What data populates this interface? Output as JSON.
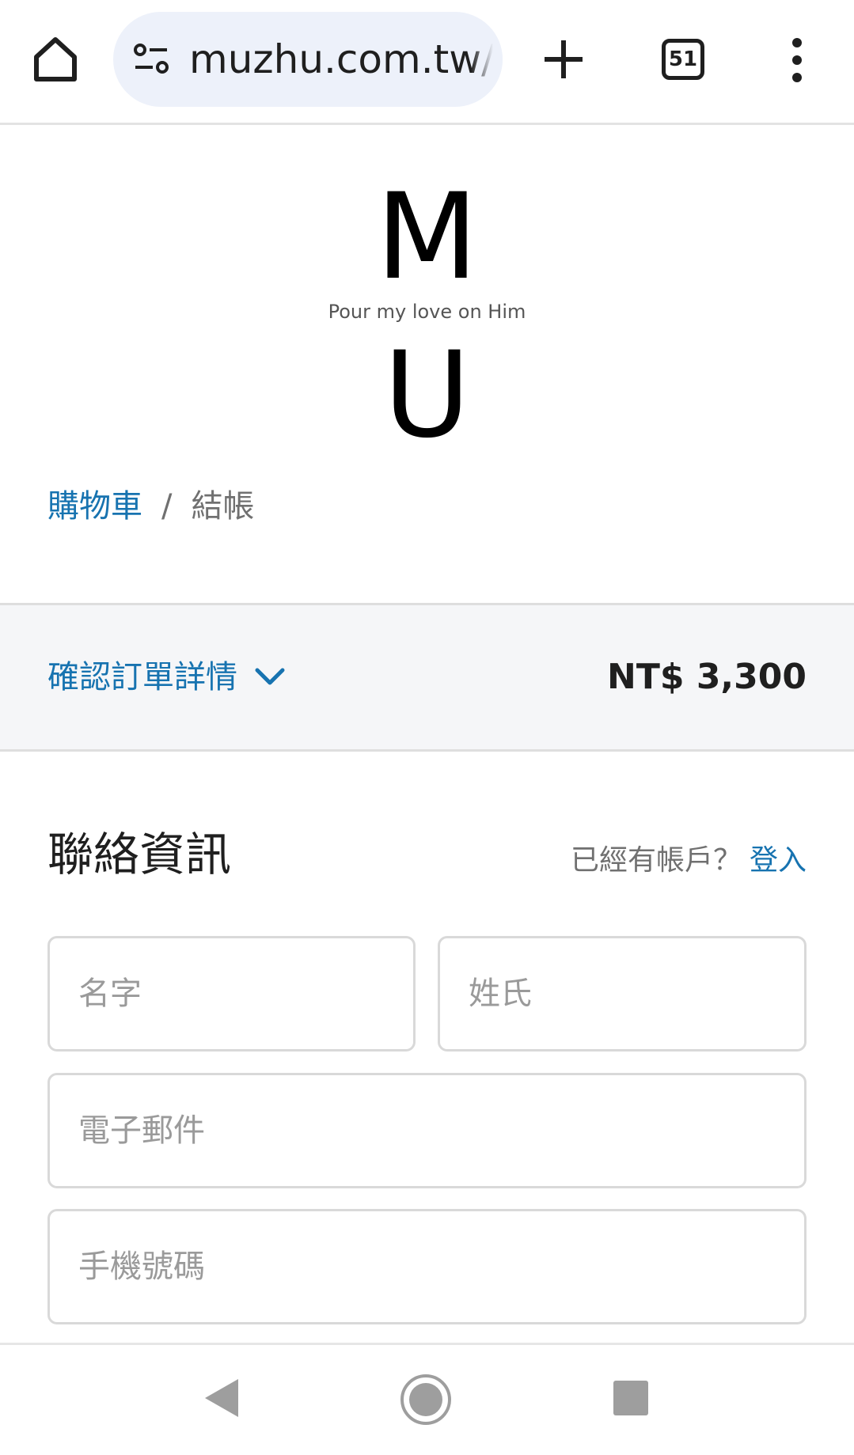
{
  "browser": {
    "url": "muzhu.com.tw/",
    "tab_count": "51",
    "icons": {
      "home": "home-icon",
      "site_settings": "tune-icon",
      "new_tab": "plus-icon",
      "tabs": "tab-switcher-icon",
      "menu": "more-vert-icon"
    }
  },
  "logo": {
    "top_letter": "M",
    "tagline": "Pour my love on Him",
    "bottom_letter": "U"
  },
  "breadcrumb": {
    "cart": "購物車",
    "separator": "/",
    "current": "結帳"
  },
  "summary": {
    "toggle_label": "確認訂單詳情",
    "total": "NT$ 3,300",
    "accent_color": "#1773b0"
  },
  "contact": {
    "title": "聯絡資訊",
    "have_account": "已經有帳戶？",
    "login": "登入",
    "first_name_placeholder": "名字",
    "last_name_placeholder": "姓氏",
    "email_placeholder": "電子郵件",
    "phone_placeholder": "手機號碼"
  },
  "navbar": {
    "icons": [
      "back-triangle-icon",
      "home-circle-icon",
      "recents-square-icon"
    ]
  }
}
